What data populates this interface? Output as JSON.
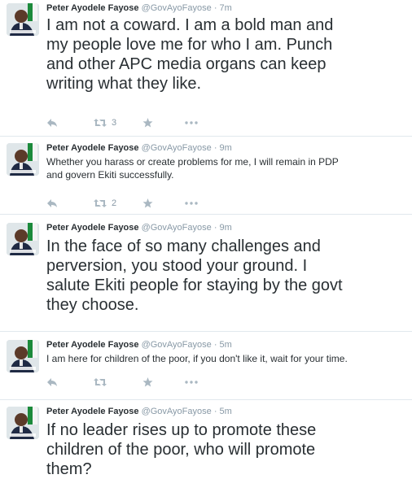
{
  "tweets": [
    {
      "name": "Peter Ayodele Fayose",
      "handle": "@GovAyoFayose",
      "separator": "·",
      "time": "7m",
      "text": "I am not a coward. I am a bold man and\nmy people love me for who I am. Punch\nand other APC media organs can keep\nwriting what they like.",
      "retweet_count": "3"
    },
    {
      "name": "Peter Ayodele Fayose",
      "handle": "@GovAyoFayose",
      "separator": "·",
      "time": "9m",
      "text": "Whether you harass or create problems for me, I will remain in PDP\nand govern Ekiti successfully.",
      "retweet_count": "2"
    },
    {
      "name": "Peter Ayodele Fayose",
      "handle": "@GovAyoFayose",
      "separator": "·",
      "time": "9m",
      "text": "In the face of so many challenges and\nperversion, you stood your ground. I\nsalute Ekiti people for staying by the govt\nthey choose.",
      "retweet_count": ""
    },
    {
      "name": "Peter Ayodele Fayose",
      "handle": "@GovAyoFayose",
      "separator": "·",
      "time": "5m",
      "text": "I am here for children of the poor, if you don't like it, wait for your time.",
      "retweet_count": ""
    },
    {
      "name": "Peter Ayodele Fayose",
      "handle": "@GovAyoFayose",
      "separator": "·",
      "time": "5m",
      "text": "If no leader rises up to promote these\nchildren of the poor, who will promote\nthem?",
      "retweet_count": ""
    }
  ],
  "icons": {
    "reply": "reply-icon",
    "retweet": "retweet-icon",
    "favorite": "star-icon",
    "more": "more-icon"
  },
  "colors": {
    "name": "#292f33",
    "meta": "#8899a6",
    "action_icon": "#aab8c2",
    "divider": "#e1e8ed"
  }
}
